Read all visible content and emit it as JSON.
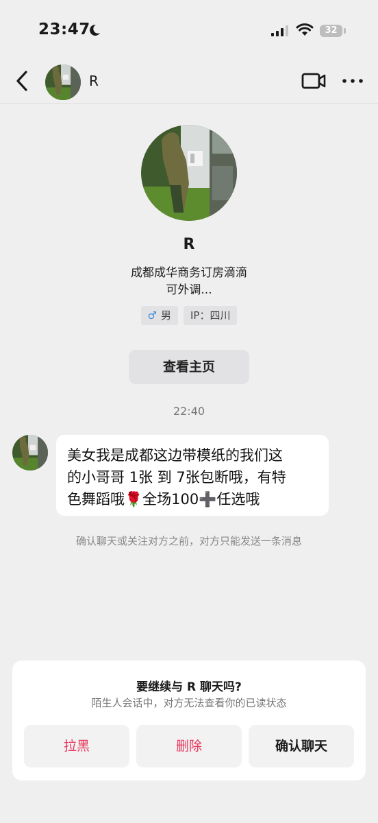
{
  "status_bar": {
    "time": "23:47",
    "battery": "32"
  },
  "nav": {
    "name": "R"
  },
  "profile": {
    "name": "R",
    "bio_line1": "成都成华商务订房滴滴",
    "bio_line2": "可外调...",
    "gender_symbol": "♂",
    "gender": "男",
    "ip": "IP：四川",
    "homepage_button": "查看主页"
  },
  "chat": {
    "timestamp": "22:40",
    "message_lines": [
      "美女我是成都这边带模纸的我们这",
      "的小哥哥 1张 到 7张包断哦，有特",
      "色舞蹈哦🌹全场100➕任选哦"
    ],
    "notice": "确认聊天或关注对方之前，对方只能发送一条消息"
  },
  "prompt_card": {
    "title": "要继续与 R 聊天吗?",
    "subtitle": "陌生人会话中，对方无法查看你的已读状态",
    "block_button": "拉黑",
    "delete_button": "删除",
    "confirm_button": "确认聊天"
  },
  "colors": {
    "accent_red": "#e8355a",
    "background": "#efeff0",
    "male_blue": "#3d8ad9"
  }
}
